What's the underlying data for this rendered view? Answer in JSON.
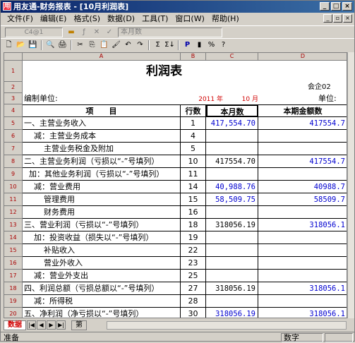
{
  "window": {
    "title": "用友通-财务报表 - [10月利润表]",
    "buttons": [
      "_",
      "□",
      "×"
    ]
  },
  "menu": [
    "文件(F)",
    "编辑(E)",
    "格式(S)",
    "数据(D)",
    "工具(T)",
    "窗口(W)",
    "帮助(H)"
  ],
  "mdi_buttons": [
    "_",
    "▫",
    "×"
  ],
  "formula_bar": {
    "cell_ref": "C4@1",
    "value": "本月数"
  },
  "toolbar_icons": [
    "new-icon",
    "open-icon",
    "save-icon",
    "print-preview-icon",
    "print-icon",
    "cut-icon",
    "copy-icon",
    "paste-icon",
    "format-painter-icon",
    "undo-icon",
    "redo-icon",
    "sum-icon",
    "sort-icon",
    "p-icon",
    "chart-icon",
    "percent-icon",
    "help-icon"
  ],
  "toolbar_glyphs": [
    "🗋",
    "📂",
    "💾",
    "🔍",
    "🖨",
    "✂",
    "⎘",
    "📋",
    "🖌",
    "↶",
    "↷",
    "Σ",
    "Σ↓",
    "P",
    "▮",
    "%",
    "?"
  ],
  "columns": [
    "A",
    "B",
    "C",
    "D"
  ],
  "sheet": {
    "title": "利润表",
    "corner_note": "会企02",
    "unit_label": "单位:",
    "company_label": "编制单位:",
    "year": "2011 年",
    "month": "10 月",
    "headers": {
      "item": "项　　目",
      "line": "行数",
      "month_amt": "本月数",
      "ytd_amt": "本期金额数"
    },
    "rows": [
      {
        "r": "5",
        "item": "一、主营业务收入",
        "indent": 0,
        "line": "1",
        "m": "417,554.70",
        "m_blue": true,
        "y": "417554.7",
        "y_blue": true
      },
      {
        "r": "6",
        "item": "减：主营业务成本",
        "indent": 2,
        "line": "4",
        "m": "",
        "m_blue": false,
        "y": "",
        "y_blue": false
      },
      {
        "r": "7",
        "item": "主营业务税金及附加",
        "indent": 4,
        "line": "5",
        "m": "",
        "m_blue": false,
        "y": "",
        "y_blue": false
      },
      {
        "r": "8",
        "item": "二、主营业务利润（亏损以“-”号填列）",
        "indent": 0,
        "line": "10",
        "m": "417554.70",
        "m_blue": false,
        "y": "417554.7",
        "y_blue": true
      },
      {
        "r": "9",
        "item": "加：其他业务利润（亏损以“-”号填列）",
        "indent": 1,
        "line": "11",
        "m": "",
        "m_blue": false,
        "y": "",
        "y_blue": false
      },
      {
        "r": "10",
        "item": "减：营业费用",
        "indent": 2,
        "line": "14",
        "m": "40,988.76",
        "m_blue": true,
        "y": "40988.7",
        "y_blue": true
      },
      {
        "r": "11",
        "item": "管理费用",
        "indent": 4,
        "line": "15",
        "m": "58,509.75",
        "m_blue": true,
        "y": "58509.7",
        "y_blue": true
      },
      {
        "r": "12",
        "item": "财务费用",
        "indent": 4,
        "line": "16",
        "m": "",
        "m_blue": false,
        "y": "",
        "y_blue": false
      },
      {
        "r": "13",
        "item": "三、营业利润（亏损以“-”号填列）",
        "indent": 0,
        "line": "18",
        "m": "318056.19",
        "m_blue": false,
        "y": "318056.1",
        "y_blue": true
      },
      {
        "r": "14",
        "item": "加：投资收益（损失以“-”号填列）",
        "indent": 2,
        "line": "19",
        "m": "",
        "m_blue": false,
        "y": "",
        "y_blue": false
      },
      {
        "r": "15",
        "item": "补贴收入",
        "indent": 4,
        "line": "22",
        "m": "",
        "m_blue": false,
        "y": "",
        "y_blue": false
      },
      {
        "r": "16",
        "item": "营业外收入",
        "indent": 4,
        "line": "23",
        "m": "",
        "m_blue": false,
        "y": "",
        "y_blue": false
      },
      {
        "r": "17",
        "item": "减：营业外支出",
        "indent": 2,
        "line": "25",
        "m": "",
        "m_blue": false,
        "y": "",
        "y_blue": false
      },
      {
        "r": "18",
        "item": "四、利润总额（亏损总额以“-”号填列）",
        "indent": 0,
        "line": "27",
        "m": "318056.19",
        "m_blue": false,
        "y": "318056.1",
        "y_blue": true
      },
      {
        "r": "19",
        "item": "减：所得税",
        "indent": 2,
        "line": "28",
        "m": "",
        "m_blue": false,
        "y": "",
        "y_blue": false
      },
      {
        "r": "20",
        "item": "五、净利润（净亏损以“-”号填列）",
        "indent": 0,
        "line": "30",
        "m": "318056.19",
        "m_blue": true,
        "y": "318056.1",
        "y_blue": true
      }
    ],
    "header_rows": [
      "1",
      "2",
      "3",
      "4"
    ]
  },
  "sheet_tabs": {
    "active": "数据",
    "other": "第",
    "nav": [
      "|◀",
      "◀",
      "▶",
      "▶|"
    ]
  },
  "status": {
    "left": "准备",
    "mode": "数字"
  }
}
